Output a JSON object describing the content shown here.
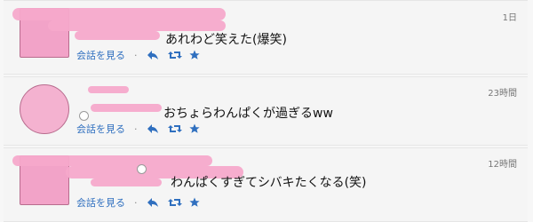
{
  "tweets": [
    {
      "text": "あれわど笑えた(爆笑)",
      "time": "1日",
      "conversation_label": "会話を見る"
    },
    {
      "text": "おちょらわんぱくが過ぎるww",
      "time": "23時間",
      "conversation_label": "会話を見る"
    },
    {
      "text": "わんぱくすぎてシバキたくなる(笑)",
      "time": "12時間",
      "conversation_label": "会話を見る"
    }
  ],
  "separator": "·",
  "icons": {
    "reply": "reply-icon",
    "retweet": "retweet-icon",
    "favorite": "star-icon"
  },
  "colors": {
    "link": "#2f6fbf",
    "redaction": "#f2a3c8"
  }
}
